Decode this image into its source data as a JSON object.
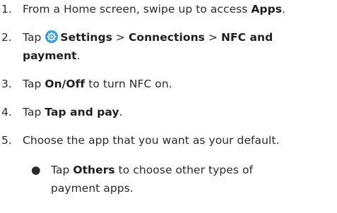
{
  "steps": [
    {
      "num": "1.",
      "pre": "From a Home screen, swipe up to access ",
      "bold": "Apps",
      "post": "."
    },
    {
      "num": "2.",
      "pre": "Tap ",
      "bold1": "Settings",
      "sep1": " > ",
      "bold2": "Connections",
      "sep2": " > ",
      "bold3": "NFC and",
      "bold3b": "payment",
      "post": "."
    },
    {
      "num": "3.",
      "pre": "Tap ",
      "bold": "On/Off",
      "post": " to turn NFC on."
    },
    {
      "num": "4.",
      "pre": "Tap ",
      "bold": "Tap and pay",
      "post": "."
    },
    {
      "num": "5.",
      "text": "Choose the app that you want as your default."
    }
  ],
  "bullet": {
    "pre": "Tap ",
    "bold": "Others",
    "post": " to choose other types of",
    "line2": "payment apps."
  },
  "icons": {
    "settings": "gear-icon",
    "accent": "#2f9ee9"
  }
}
